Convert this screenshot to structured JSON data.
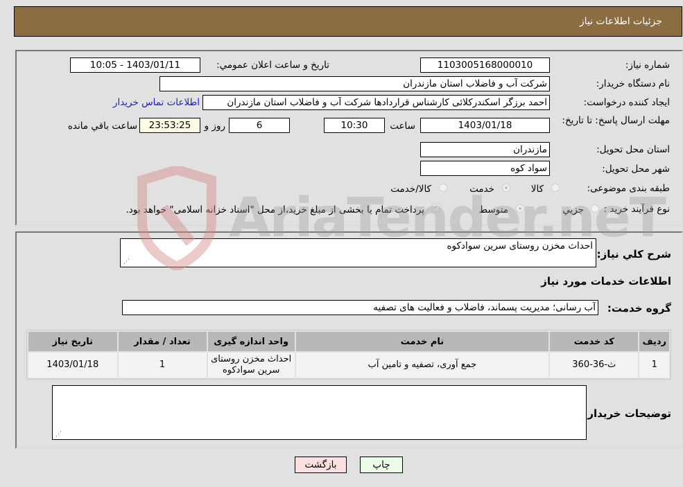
{
  "header": {
    "title": "جزئیات اطلاعات نیاز"
  },
  "details": {
    "need_number_label": "شماره نیاز:",
    "need_number": "1103005168000010",
    "announce_label": "تاریخ و ساعت اعلان عمومي:",
    "announce_value": "1403/01/11 - 10:05",
    "buyer_org_label": "نام دستگاه خريدار:",
    "buyer_org": "شرکت آب و فاضلاب استان مازندران",
    "creator_label": "ایجاد کننده درخواست:",
    "creator": "احمد برزگر اسکندرکلائی کارشناس قراردادها شرکت آب و فاضلاب استان مازندران",
    "contact_link": "اطلاعات تماس خريدار",
    "deadline_label": "مهلت ارسال پاسخ: تا تاریخ:",
    "deadline_date": "1403/01/18",
    "time_label": "ساعت",
    "deadline_time": "10:30",
    "days_value": "6",
    "days_label": "روز و",
    "remaining_time": "23:53:25",
    "remaining_label": "ساعت باقي مانده",
    "province_label": "استان محل تحویل:",
    "province": "مازندران",
    "city_label": "شهر محل تحویل:",
    "city": "سواد کوه",
    "category_label": "طبقه بندی موضوعی:",
    "category_options": [
      {
        "label": "کالا",
        "checked": false
      },
      {
        "label": "خدمت",
        "checked": true
      },
      {
        "label": "کالا/خدمت",
        "checked": false
      }
    ],
    "process_label": "نوع فرآیند خرید :",
    "process_options": [
      {
        "label": "جزيي",
        "checked": false
      },
      {
        "label": "متوسط",
        "checked": true
      }
    ],
    "treasury_note": "پرداخت تمام یا بخشی از مبلغ خرید،از محل \"اسناد خزانه اسلامی\" خواهد بود.",
    "treasury_checked": true
  },
  "summary": {
    "description_label": "شرح کلي نياز:",
    "description": "احداث مخزن روستای سرین سوادکوه",
    "services_heading": "اطلاعات خدمات مورد نیاز",
    "service_group_label": "گروه خدمت:",
    "service_group": "آب رسانی؛ مدیریت پسماند، فاضلاب و فعالیت های تصفیه"
  },
  "table": {
    "headers": [
      "ردیف",
      "کد خدمت",
      "نام خدمت",
      "واحد اندازه گیری",
      "تعداد / مقدار",
      "تاریخ نیاز"
    ],
    "rows": [
      [
        "1",
        "ث-36-360",
        "جمع آوری، تصفیه و تامین آب",
        "احداث مخزن روستای سرین سوادکوه",
        "1",
        "1403/01/18"
      ]
    ]
  },
  "buyer_notes": {
    "label": "توضیحات خریدار:",
    "value": ""
  },
  "buttons": {
    "print": "چاپ",
    "back": "بازگشت"
  },
  "watermark": {
    "text": "AriaTender.neT"
  }
}
